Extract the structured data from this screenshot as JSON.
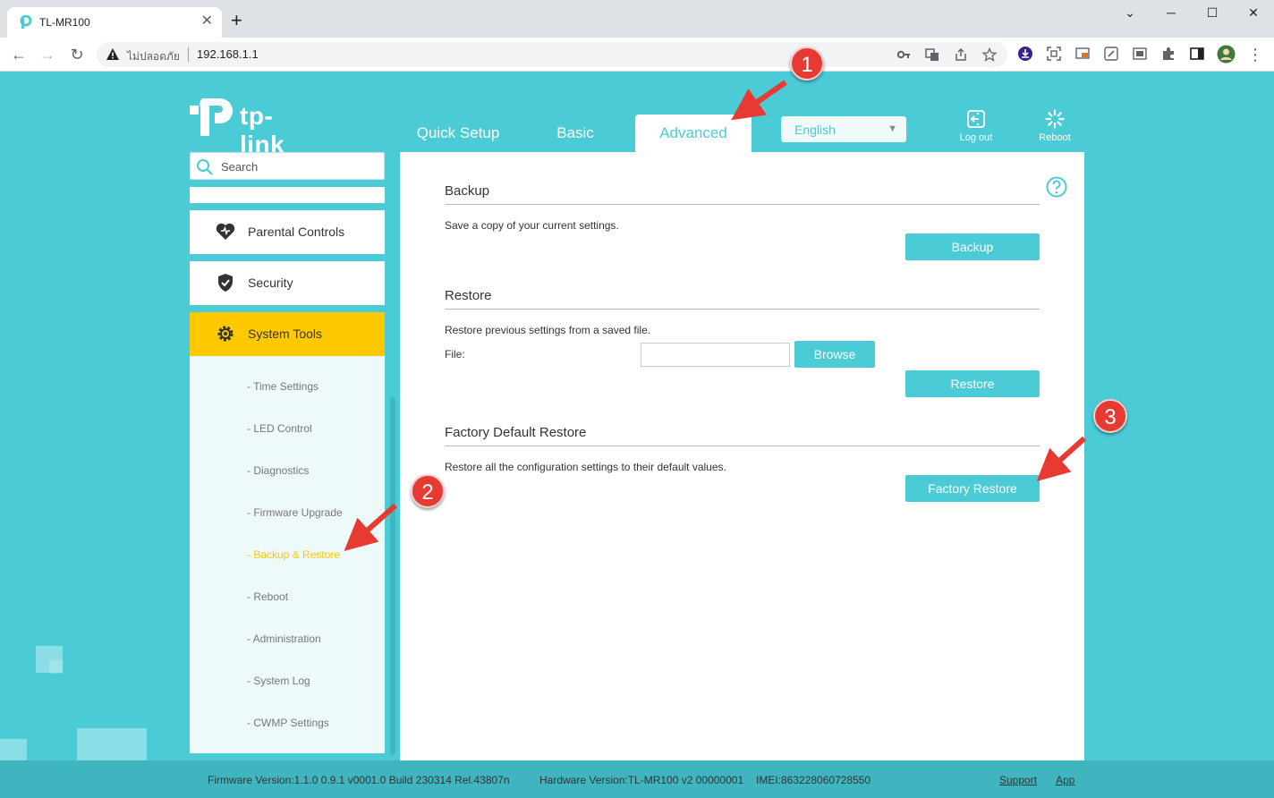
{
  "browser": {
    "tab_title": "TL-MR100",
    "new_tab": "+",
    "close_tab": "✕",
    "window_min": "─",
    "window_max": "☐",
    "window_close": "✕",
    "insecure_label": "ไม่ปลอดภัย",
    "url": "192.168.1.1"
  },
  "header": {
    "logo_text": "tp-link",
    "nav": [
      {
        "label": "Quick Setup"
      },
      {
        "label": "Basic"
      },
      {
        "label": "Advanced"
      }
    ],
    "language": "English",
    "logout_label": "Log out",
    "reboot_label": "Reboot"
  },
  "sidebar": {
    "search_placeholder": "Search",
    "menu": [
      {
        "label": "Parental Controls"
      },
      {
        "label": "Security"
      },
      {
        "label": "System Tools"
      }
    ],
    "submenu": [
      {
        "label": "- Time Settings"
      },
      {
        "label": "- LED Control"
      },
      {
        "label": "- Diagnostics"
      },
      {
        "label": "- Firmware Upgrade"
      },
      {
        "label": "- Backup & Restore"
      },
      {
        "label": "- Reboot"
      },
      {
        "label": "- Administration"
      },
      {
        "label": "- System Log"
      },
      {
        "label": "- CWMP Settings"
      }
    ]
  },
  "content": {
    "backup": {
      "title": "Backup",
      "desc": "Save a copy of your current settings.",
      "button": "Backup"
    },
    "restore": {
      "title": "Restore",
      "desc": "Restore previous settings from a saved file.",
      "file_label": "File:",
      "file_value": "",
      "browse_button": "Browse",
      "button": "Restore"
    },
    "factory": {
      "title": "Factory Default Restore",
      "desc": "Restore all the configuration settings to their default values.",
      "button": "Factory Restore"
    }
  },
  "footer": {
    "firmware": "Firmware Version:1.1.0 0.9.1 v0001.0 Build 230314 Rel.43807n",
    "hardware": "Hardware Version:TL-MR100 v2 00000001",
    "imei": "IMEI:863228060728550",
    "support": "Support",
    "app": "App"
  },
  "annotations": {
    "marker1": "1",
    "marker2": "2",
    "marker3": "3"
  },
  "colors": {
    "brand": "#4acbd6",
    "active_menu": "#ffc900",
    "marker": "#e63a33"
  }
}
